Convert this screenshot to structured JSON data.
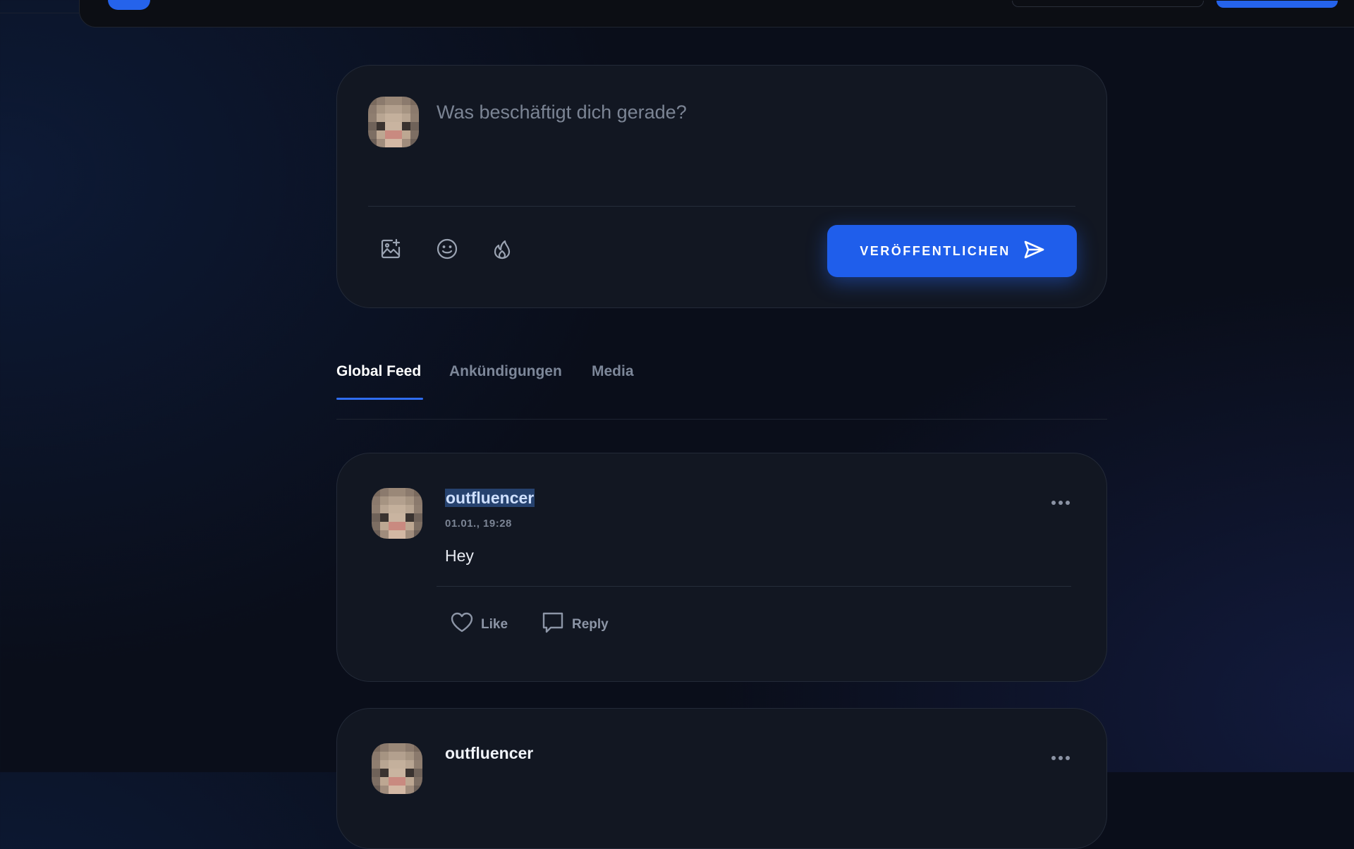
{
  "composer": {
    "placeholder": "Was beschäftigt dich gerade?",
    "publish_label": "VERÖFFENTLICHEN",
    "icons": [
      "image-add-icon",
      "emoji-icon",
      "flame-icon",
      "send-icon"
    ]
  },
  "tabs": [
    {
      "label": "Global Feed",
      "active": true
    },
    {
      "label": "Ankündigungen",
      "active": false
    },
    {
      "label": "Media",
      "active": false
    }
  ],
  "posts": [
    {
      "username": "outfluencer",
      "timestamp": "01.01., 19:28",
      "content": "Hey",
      "like_label": "Like",
      "reply_label": "Reply"
    },
    {
      "username": "outfluencer"
    }
  ],
  "colors": {
    "accent": "#1f5eeb",
    "background": "#0a0e1a",
    "card": "#121722",
    "muted_text": "#7d8799"
  }
}
